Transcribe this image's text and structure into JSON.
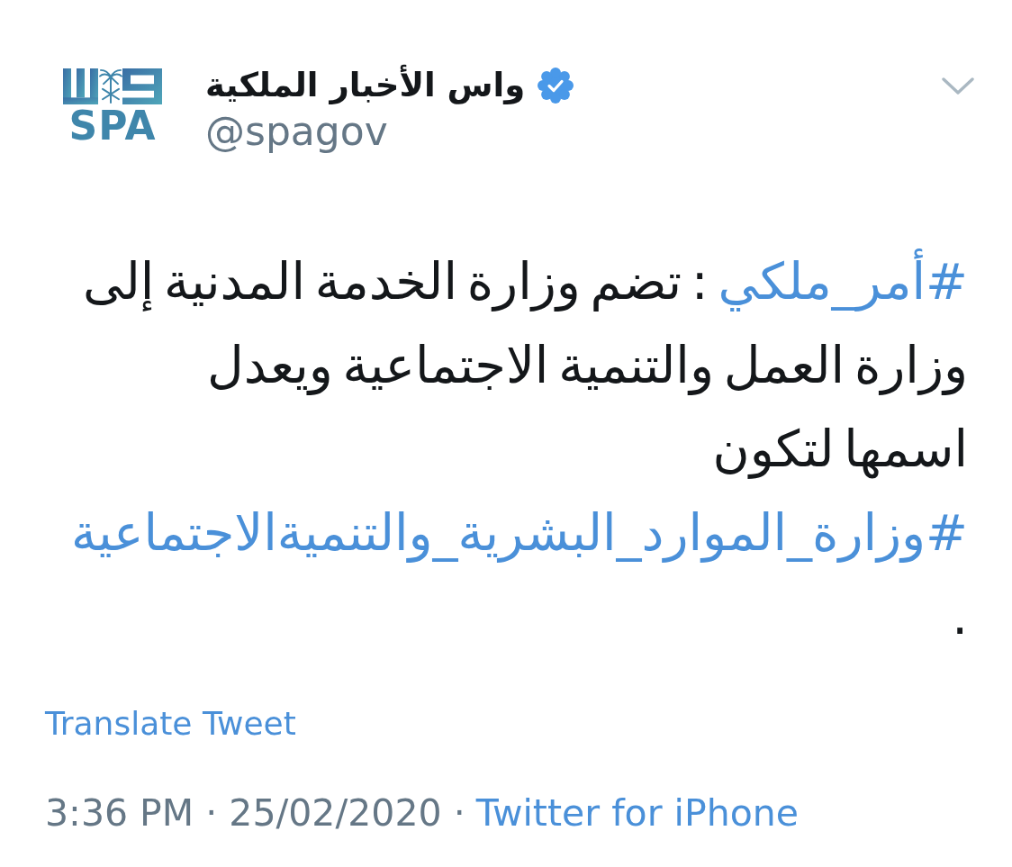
{
  "tweet": {
    "author": {
      "logo_text": "SPA",
      "name": "واس الأخبار الملكية",
      "verified": true,
      "handle": "@spagov"
    },
    "text": [
      {
        "kind": "hashtag",
        "text": "#أمر_ملكي"
      },
      {
        "kind": "plain",
        "text": " : تضم وزارة الخدمة المدنية إلى وزارة العمل والتنمية الاجتماعية ويعدل اسمها لتكون "
      },
      {
        "kind": "hashtag",
        "text": "#وزارة_الموارد_البشرية_والتنميةالاجتماعية"
      },
      {
        "kind": "plain",
        "text": " ."
      }
    ],
    "translate_label": "Translate Tweet",
    "timestamp": "3:36 PM · 25/02/2020 ·",
    "source": "Twitter for iPhone"
  }
}
